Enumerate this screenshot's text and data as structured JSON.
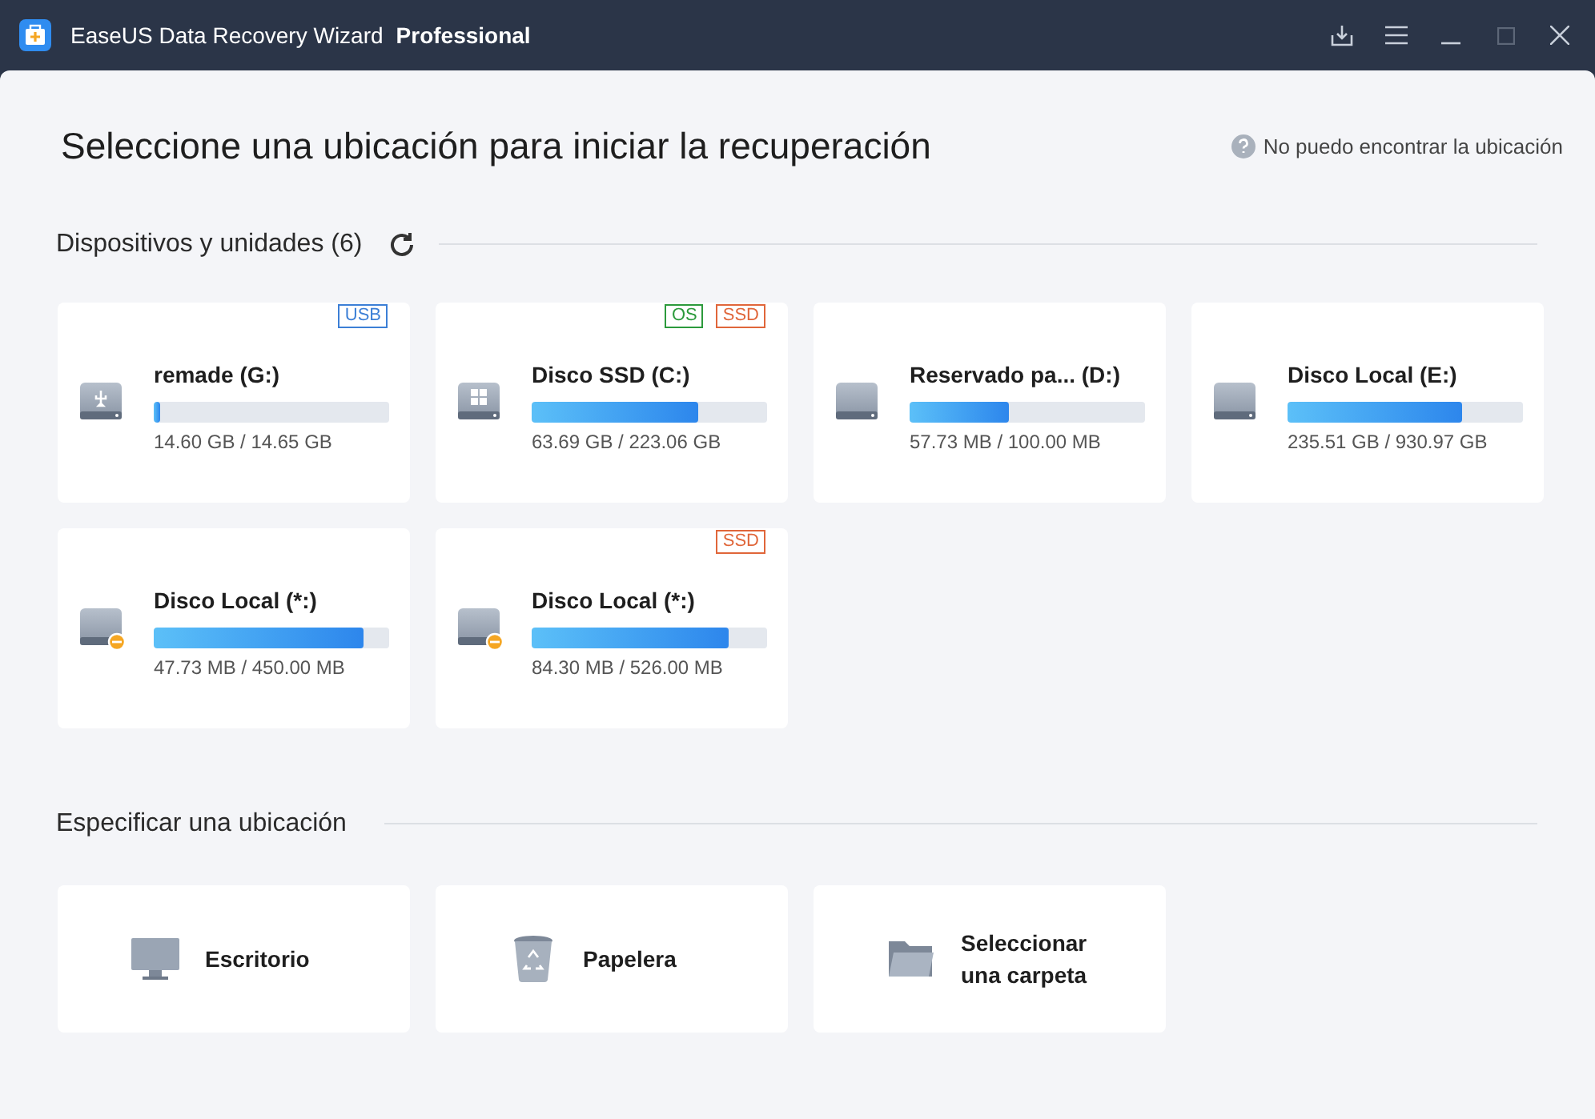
{
  "window": {
    "title": "EaseUS Data Recovery Wizard",
    "edition": "Professional"
  },
  "heading": "Seleccione una ubicación para iniciar la recuperación",
  "help_link": "No puedo encontrar la ubicación",
  "devices_section": {
    "title": "Dispositivos y unidades (6)",
    "drives": [
      {
        "name": "remade (G:)",
        "kind": "usb",
        "level": 0.03,
        "usage": "14.60 GB / 14.65 GB",
        "tags": [
          {
            "label": "USB",
            "color": "#3c7fd6"
          }
        ]
      },
      {
        "name": "Disco SSD (C:)",
        "kind": "windows",
        "level": 0.71,
        "usage": "63.69 GB / 223.06 GB",
        "tags": [
          {
            "label": "OS",
            "color": "#2c9a3c"
          },
          {
            "label": "SSD",
            "color": "#e0663a"
          }
        ]
      },
      {
        "name": "Reservado pa... (D:)",
        "kind": "plain",
        "level": 0.42,
        "usage": "57.73 MB / 100.00 MB"
      },
      {
        "name": "Disco Local (E:)",
        "kind": "plain",
        "level": 0.74,
        "usage": "235.51 GB / 930.97 GB"
      },
      {
        "name": "Disco Local (*:)",
        "kind": "lost",
        "level": 0.89,
        "usage": "47.73 MB / 450.00 MB"
      },
      {
        "name": "Disco Local (*:)",
        "kind": "lost",
        "level": 0.84,
        "usage": "84.30 MB / 526.00 MB",
        "tags": [
          {
            "label": "SSD",
            "color": "#e0663a"
          }
        ]
      }
    ]
  },
  "locations_section": {
    "title": "Especificar una ubicación",
    "locations": [
      {
        "name": "Escritorio",
        "kind": "desktop"
      },
      {
        "name": "Papelera",
        "kind": "trash"
      },
      {
        "name": "Seleccionar una carpeta",
        "kind": "folder"
      }
    ]
  }
}
